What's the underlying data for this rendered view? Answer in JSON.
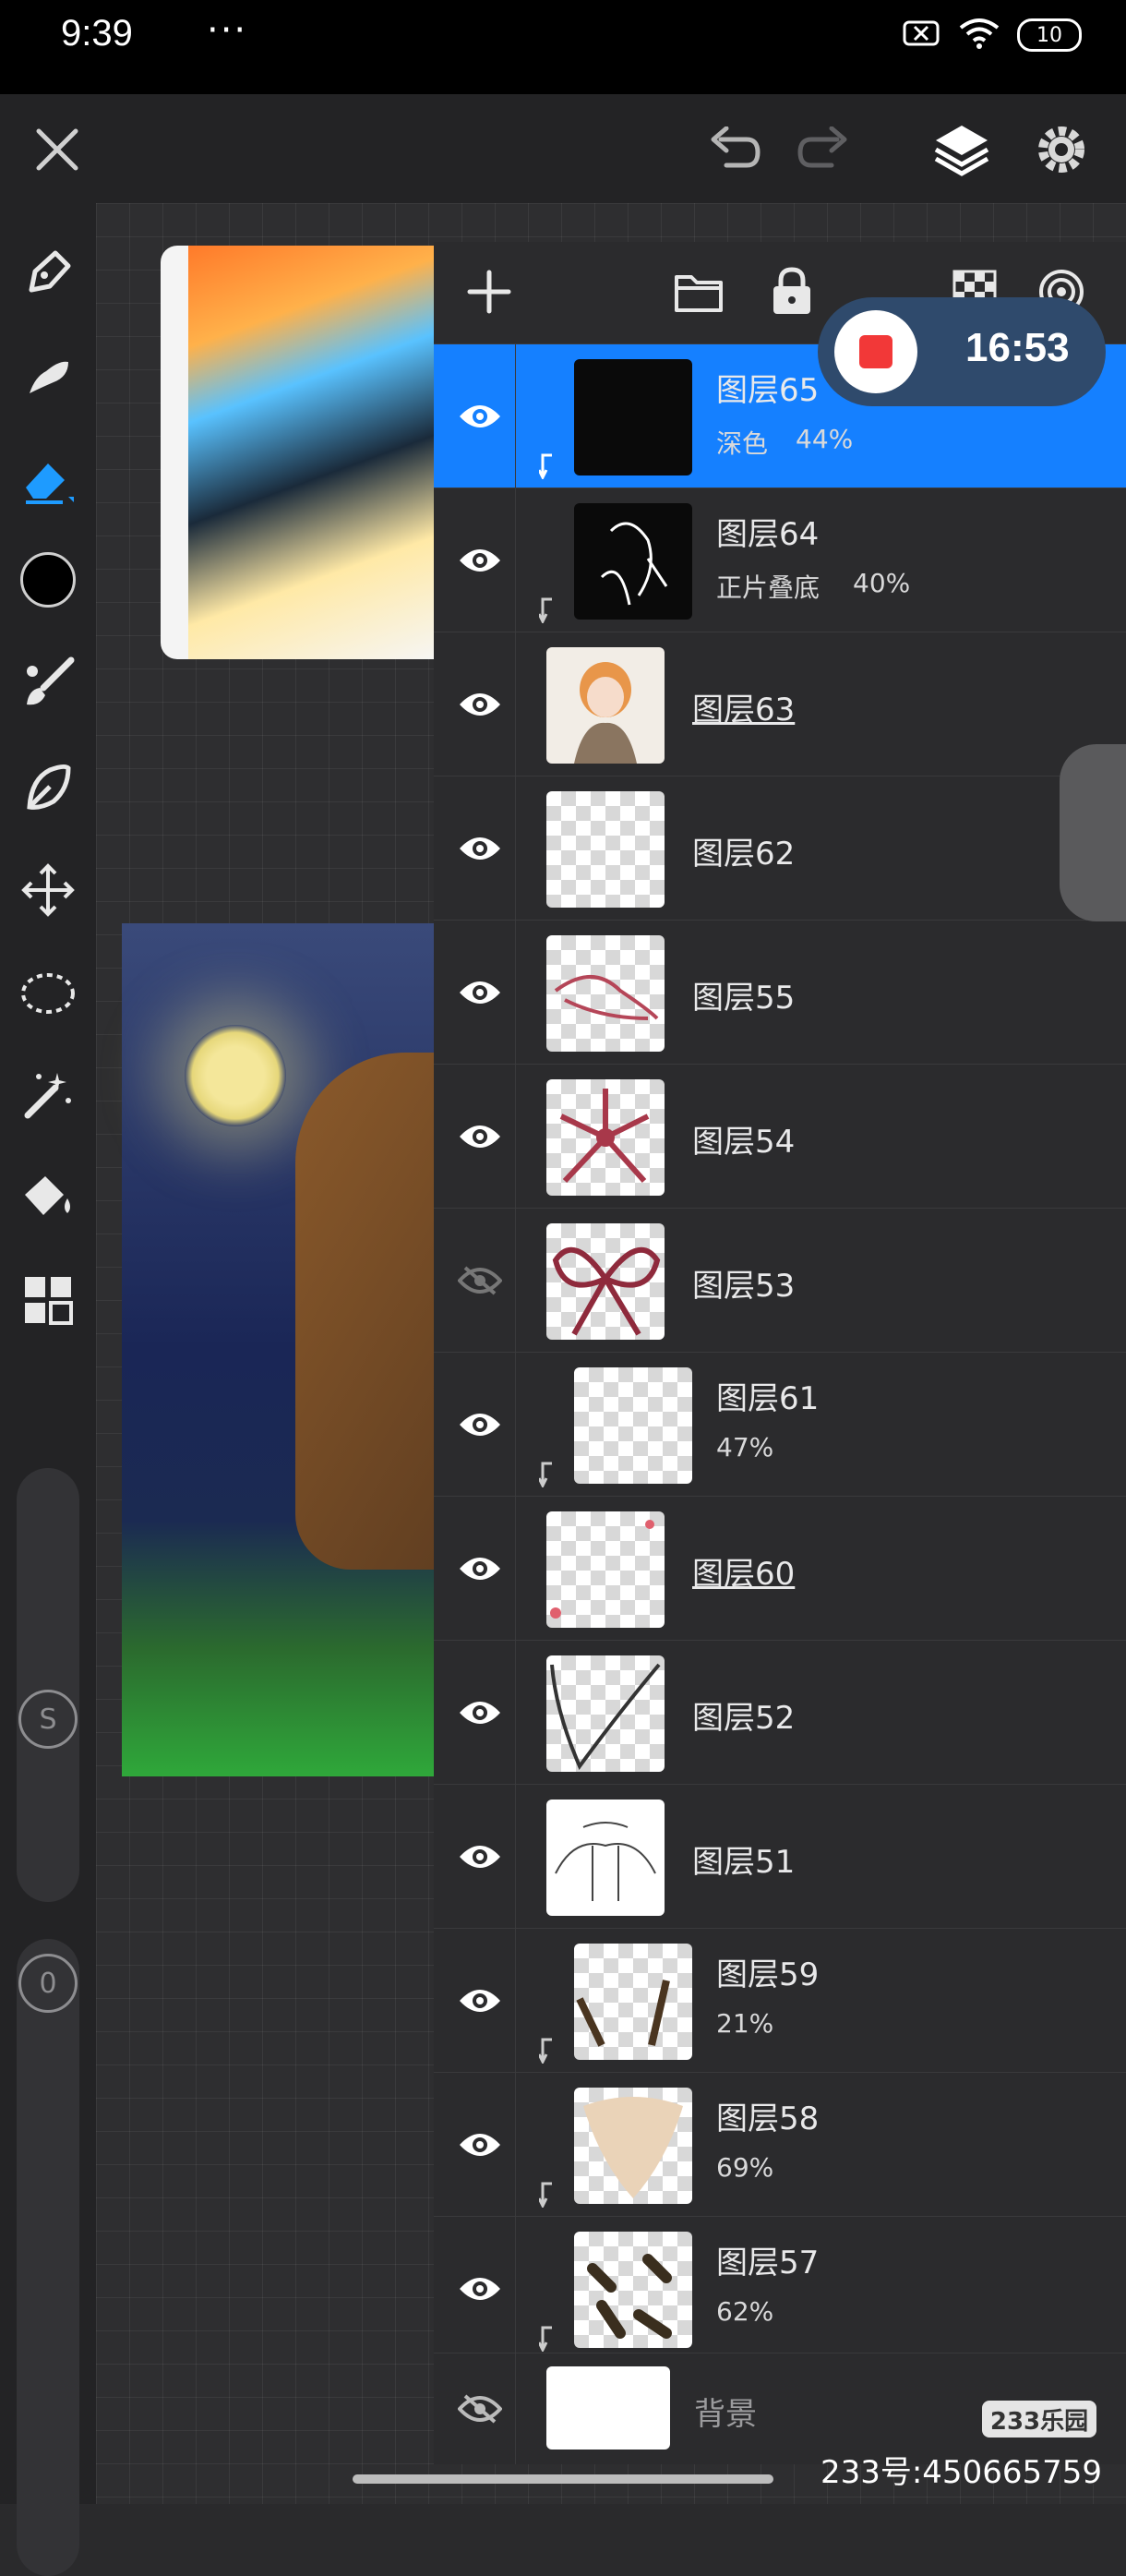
{
  "status_bar": {
    "time": "9:39",
    "dots": "···",
    "battery": "10"
  },
  "record": {
    "elapsed": "16:53"
  },
  "left_tools": {
    "size_badge": "S",
    "opacity_badge": "0"
  },
  "layers": [
    {
      "name": "图层65",
      "mode": "深色",
      "opacity": "44%",
      "clipped": true,
      "visible": true,
      "selected": true,
      "thumb": "dark"
    },
    {
      "name": "图层64",
      "mode": "正片叠底",
      "opacity": "40%",
      "clipped": true,
      "visible": true,
      "thumb": "dark"
    },
    {
      "name": "图层63",
      "clipped": false,
      "visible": true,
      "underline": true,
      "thumb": "character"
    },
    {
      "name": "图层62",
      "clipped": false,
      "visible": true,
      "thumb": "transparent"
    },
    {
      "name": "图层55",
      "clipped": false,
      "visible": true,
      "thumb": "ribbon"
    },
    {
      "name": "图层54",
      "clipped": false,
      "visible": true,
      "thumb": "flower"
    },
    {
      "name": "图层53",
      "clipped": false,
      "visible": false,
      "thumb": "bow"
    },
    {
      "name": "图层61",
      "opacity": "47%",
      "clipped": true,
      "visible": true,
      "thumb": "transparent"
    },
    {
      "name": "图层60",
      "clipped": false,
      "visible": true,
      "underline": true,
      "thumb": "transparent"
    },
    {
      "name": "图层52",
      "clipped": false,
      "visible": true,
      "thumb": "lines"
    },
    {
      "name": "图层51",
      "clipped": false,
      "visible": true,
      "thumb": "sketch"
    },
    {
      "name": "图层59",
      "opacity": "21%",
      "clipped": true,
      "visible": true,
      "thumb": "transparent"
    },
    {
      "name": "图层58",
      "opacity": "69%",
      "clipped": true,
      "visible": true,
      "thumb": "beige"
    },
    {
      "name": "图层57",
      "opacity": "62%",
      "clipped": true,
      "visible": true,
      "thumb": "marks"
    }
  ],
  "background_layer": {
    "name": "背景",
    "visible": false
  },
  "watermark": {
    "badge": "233乐园",
    "id_text": "233号:450665759"
  },
  "colors": {
    "selected_row": "#1580ff",
    "record_red": "#f23838",
    "accent_blue": "#1e9bff"
  }
}
